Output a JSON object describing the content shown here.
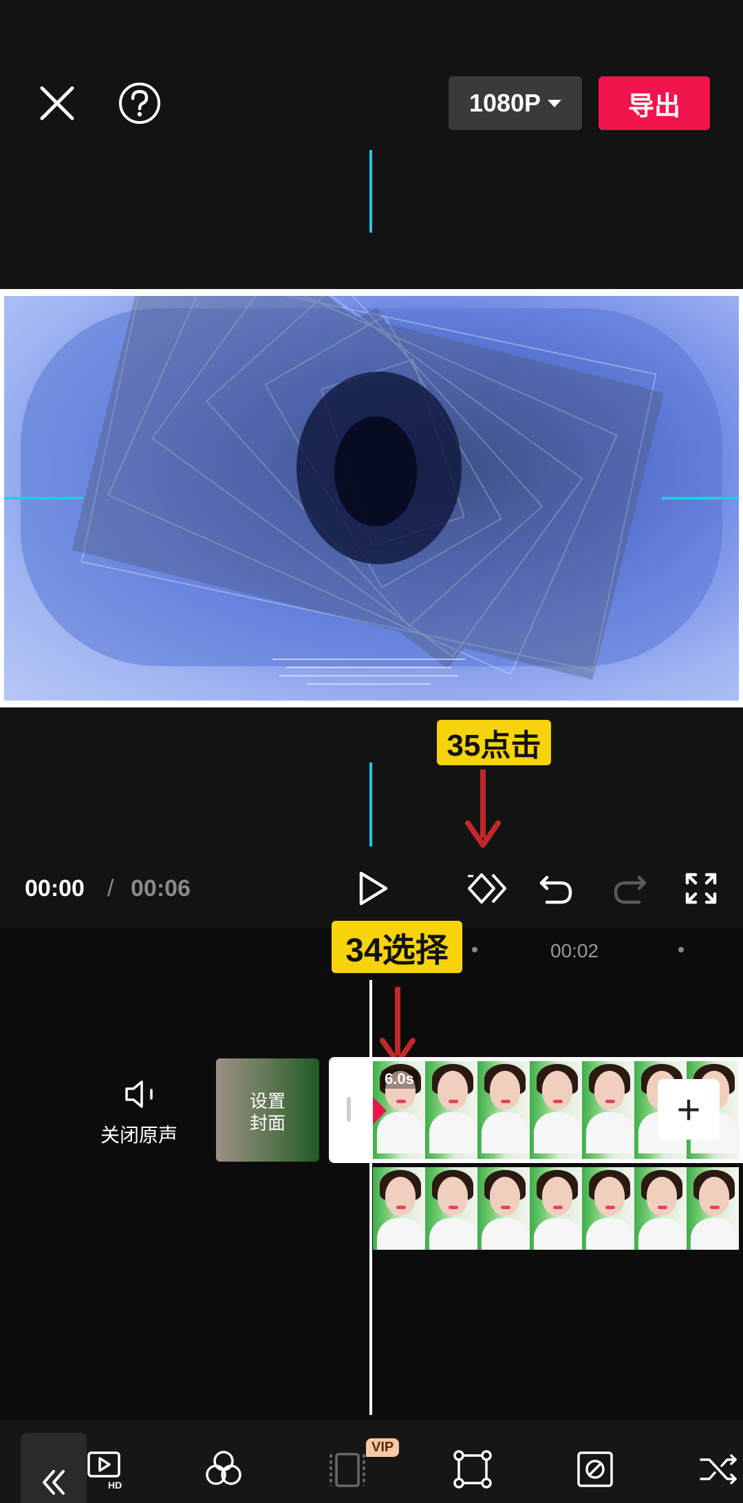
{
  "header": {
    "close_icon": "close-icon",
    "help_icon": "help-icon",
    "resolution": "1080P",
    "export_label": "导出"
  },
  "player": {
    "current_time": "00:00",
    "separator": "/",
    "total_time": "00:06"
  },
  "annotations": {
    "step_35": "35点击",
    "step_34": "34选择"
  },
  "timeline": {
    "ruler_mark": "00:02",
    "mute_label": "关闭原声",
    "cover_label_line1": "设置",
    "cover_label_line2": "封面",
    "clip_duration": "6.0s",
    "add_symbol": "+"
  },
  "toolbar": {
    "collapse_icon": "double-chevron-left-icon",
    "vip_badge": "VIP",
    "tools": [
      "hd-icon",
      "effects-icon",
      "vip-clip-icon",
      "crop-icon",
      "mask-icon",
      "shuffle-icon"
    ]
  },
  "colors": {
    "accent_red": "#f1134c",
    "guide_cyan": "#19d0e6",
    "callout_yellow": "#f6d30a",
    "annotation_arrow": "#c0282a"
  }
}
